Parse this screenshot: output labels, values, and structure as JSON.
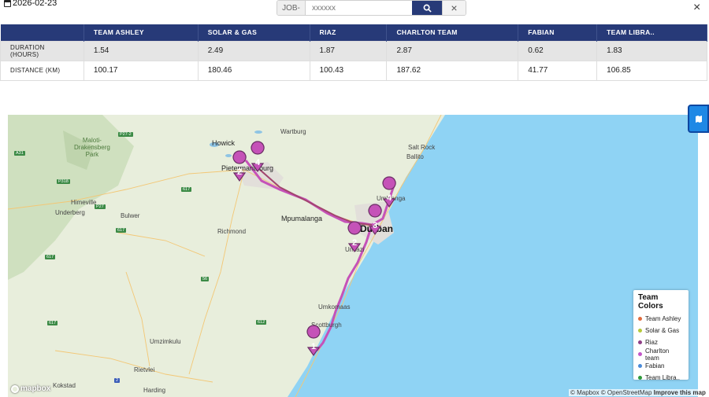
{
  "header": {
    "date": "2026-02-23",
    "job_prefix": "JOB-",
    "job_placeholder": "xxxxxx",
    "close_glyph": "×",
    "clear_glyph": "×"
  },
  "table": {
    "columns": [
      "",
      "TEAM ASHLEY",
      "SOLAR & GAS",
      "RIAZ",
      "CHARLTON TEAM",
      "FABIAN",
      "TEAM LIBRA.."
    ],
    "rows": [
      {
        "label": "DURATION (HOURS)",
        "values": [
          "1.54",
          "2.49",
          "1.87",
          "2.87",
          "0.62",
          "1.83"
        ]
      },
      {
        "label": "DISTANCE (KM)",
        "values": [
          "100.17",
          "180.46",
          "100.43",
          "187.62",
          "41.77",
          "106.85"
        ]
      }
    ]
  },
  "map": {
    "places": {
      "howick": "Howick",
      "wartburg": "Wartburg",
      "maloti": "Maloti-\nDrakensberg\nPark",
      "pietermaritzburg": "Pietermaritzburg",
      "himeville": "Himeville",
      "underberg": "Underberg",
      "bulwer": "Bulwer",
      "richmond": "Richmond",
      "mpumalanga": "Mpumalanga",
      "durban": "Durban",
      "umlazi": "Umlazi",
      "umhlanga": "Umhlanga",
      "saltrock": "Salt Rock",
      "ballito": "Ballito",
      "umkomaas": "Umkomaas",
      "scottburgh": "Scottburgh",
      "umzimkulu": "Umzimkulu",
      "rietvlei": "Rietvlei",
      "kokstad": "Kokstad",
      "harding": "Harding"
    },
    "roads": {
      "a31": "A31",
      "p27": "P27-2",
      "p318": "P318",
      "p27b": "P27",
      "r617a": "617",
      "r617b": "617",
      "r617c": "617",
      "r617d": "617",
      "r612": "612",
      "r56": "56",
      "n2": "2"
    },
    "markers": [
      "1",
      "2",
      "2",
      "3",
      "4",
      "4"
    ],
    "attribution_left": "© Mapbox © OpenStreetMap",
    "attribution_right": "Improve this map",
    "logo": "mapbox"
  },
  "legend": {
    "title": "Team Colors",
    "items": [
      {
        "label": "Team Ashley",
        "color": "#e06b3c"
      },
      {
        "label": "Solar & Gas",
        "color": "#b5c93a"
      },
      {
        "label": "Riaz",
        "color": "#8e3f86"
      },
      {
        "label": "Charlton team",
        "color": "#c256c8"
      },
      {
        "label": "Fabian",
        "color": "#4a8ad8"
      },
      {
        "label": "Team Libra..",
        "color": "#2e9a3a"
      }
    ]
  },
  "colors": {
    "header_bg": "#273a78",
    "route": "#c552b8",
    "route2": "#a2456e",
    "water": "#8fd3f4",
    "accent_button": "#1e88e5"
  }
}
